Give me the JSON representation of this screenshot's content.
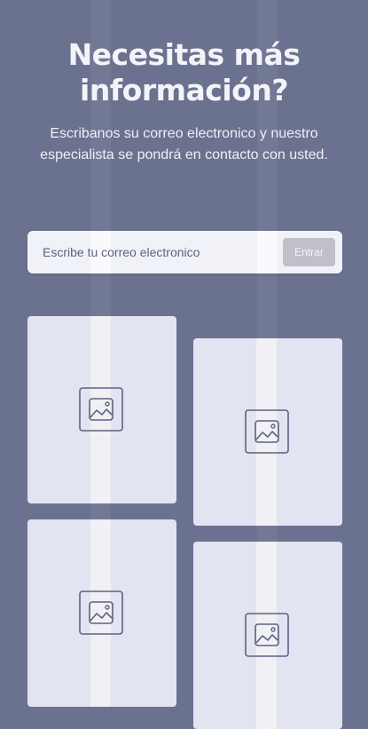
{
  "hero": {
    "title_line1": "Necesitas más",
    "title_line2": "información?",
    "subtitle": "Escribanos su correo electronico y nuestro especialista se pondrá en contacto con usted."
  },
  "subscribe": {
    "placeholder": "Escribe tu correo electronico",
    "button_label": "Entrar"
  },
  "gallery": {
    "cards": [
      {
        "icon": "image-placeholder-icon"
      },
      {
        "icon": "image-placeholder-icon"
      },
      {
        "icon": "image-placeholder-icon"
      },
      {
        "icon": "image-placeholder-icon"
      }
    ]
  },
  "colors": {
    "background": "#6b7290",
    "card": "#e3e4f1",
    "button": "#bfc0c8",
    "icon_stroke": "#5d6380"
  }
}
